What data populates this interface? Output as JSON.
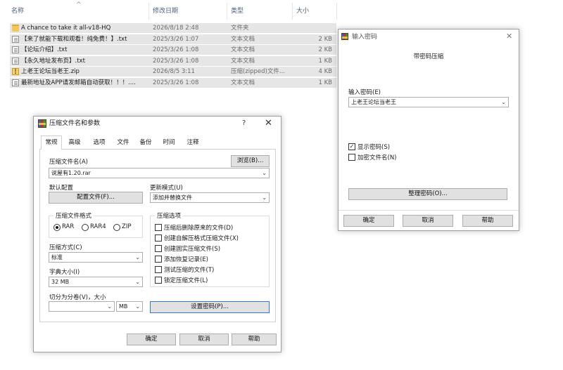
{
  "explorer": {
    "columns": {
      "name": "名称",
      "date": "修改日期",
      "type": "类型",
      "size": "大小"
    },
    "files": [
      {
        "icon": "folder-icon",
        "name": "A chance to take it all-v18-HQ",
        "date": "2026/8/18 2:48",
        "type": "文件夹",
        "size": ""
      },
      {
        "icon": "text-file-icon",
        "name": "【来了就能下载和观看！纯免费！】.txt",
        "date": "2025/3/26 1:07",
        "type": "文本文档",
        "size": "2 KB"
      },
      {
        "icon": "text-file-icon",
        "name": "【论坛介绍】.txt",
        "date": "2025/3/26 1:08",
        "type": "文本文档",
        "size": "2 KB"
      },
      {
        "icon": "text-file-icon",
        "name": "【永久地址发布页】.txt",
        "date": "2025/3/26 1:08",
        "type": "文本文档",
        "size": "1 KB"
      },
      {
        "icon": "zip-file-icon",
        "name": "上老王论坛当老王.zip",
        "date": "2026/8/5 3:11",
        "type": "压缩(zipped)文件...",
        "size": "4 KB"
      },
      {
        "icon": "text-file-icon",
        "name": "最新地址及APP请发邮箱自动获取！！！....",
        "date": "2025/3/26 1:08",
        "type": "文本文档",
        "size": "1 KB"
      }
    ]
  },
  "archive_dialog": {
    "title": "压缩文件名和参数",
    "help": "?",
    "close": "✕",
    "tabs": [
      "常规",
      "高级",
      "选项",
      "文件",
      "备份",
      "时间",
      "注释"
    ],
    "archive_name_label": "压缩文件名(A)",
    "browse_button": "浏览(B)...",
    "archive_name_value": "说屋有1.20.rar",
    "default_profile_label": "默认配置",
    "profiles_button": "配置文件(F)...",
    "update_mode_label": "更新模式(U)",
    "update_mode_value": "添加并替换文件",
    "format_group": "压缩文件格式",
    "formats": [
      "RAR",
      "RAR4",
      "ZIP"
    ],
    "selected_format": "RAR",
    "method_label": "压缩方式(C)",
    "method_value": "标准",
    "dict_label": "字典大小(I)",
    "dict_value": "32 MB",
    "split_label": "切分为分卷(V)，大小",
    "split_value": "",
    "split_unit": "MB",
    "options_group": "压缩选项",
    "options": [
      {
        "label": "压缩后删除原来的文件(D)",
        "checked": false
      },
      {
        "label": "创建自解压格式压缩文件(X)",
        "checked": false
      },
      {
        "label": "创建固实压缩文件(S)",
        "checked": false
      },
      {
        "label": "添加恢复记录(E)",
        "checked": false
      },
      {
        "label": "测试压缩的文件(T)",
        "checked": false
      },
      {
        "label": "锁定压缩文件(L)",
        "checked": false
      }
    ],
    "set_password_button": "设置密码(P)...",
    "ok_button": "确定",
    "cancel_button": "取消",
    "help_button": "帮助"
  },
  "password_dialog": {
    "title": "输入密码",
    "close": "✕",
    "heading": "带密码压缩",
    "password_label": "输入密码(E)",
    "password_value": "上老王论坛当老王",
    "show_password_label": "显示密码(S)",
    "show_password_checked": true,
    "encrypt_names_label": "加密文件名(N)",
    "encrypt_names_checked": false,
    "organize_button": "整理密码(O)...",
    "ok_button": "确定",
    "cancel_button": "取消",
    "help_button": "帮助"
  },
  "colors": {
    "row_selected": "#e6e6e6",
    "focus_border": "#2d7ad6",
    "button_face": "#e1e1e1"
  }
}
